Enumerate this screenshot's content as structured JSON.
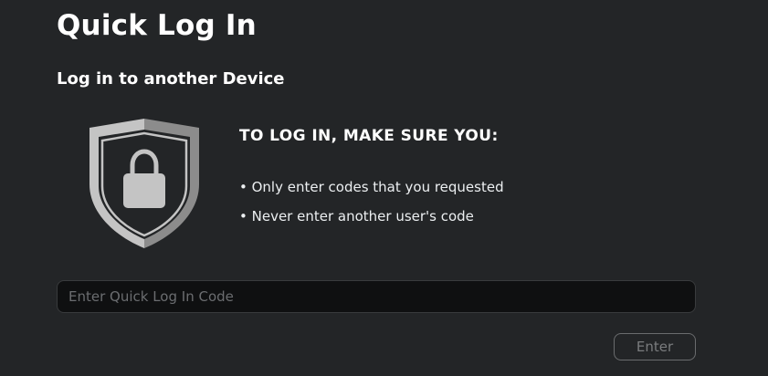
{
  "page": {
    "title": "Quick Log In",
    "section_title": "Log in to another Device"
  },
  "security_notice": {
    "icon": "shield-lock-icon",
    "heading": "TO LOG IN, MAKE SURE YOU:",
    "items": [
      "• Only enter codes that you requested",
      "• Never enter another user's code"
    ]
  },
  "code_form": {
    "placeholder": "Enter Quick Log In Code",
    "value": "",
    "enter_label": "Enter",
    "enter_disabled": true
  },
  "colors": {
    "background": "#232527",
    "text": "#ffffff",
    "input_background": "#0f1011",
    "shield_light": "#c4c4c4",
    "shield_dark": "#8c8c8c"
  }
}
